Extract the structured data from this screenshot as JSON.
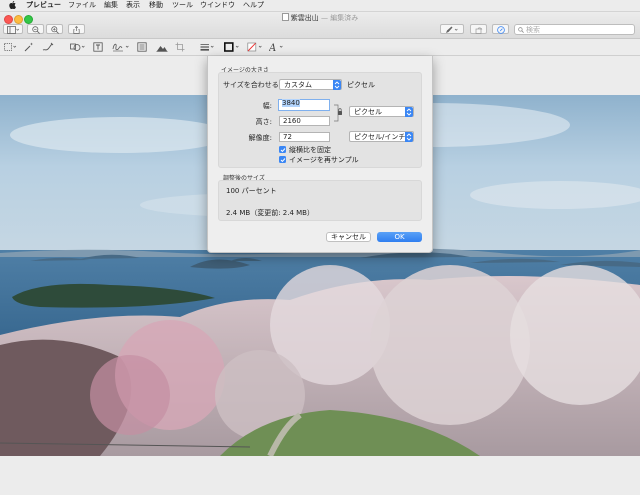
{
  "menubar": {
    "app": "プレビュー",
    "items": [
      "ファイル",
      "編集",
      "表示",
      "移動",
      "ツール",
      "ウインドウ",
      "ヘルプ"
    ]
  },
  "window": {
    "title": "紫雲出山",
    "edited": "— 編集済み"
  },
  "search": {
    "placeholder": "検索"
  },
  "dialog": {
    "image_size_label": "イメージの大きさ",
    "fit_label": "サイズを合わせる:",
    "fit_value": "カスタム",
    "fit_unit": "ピクセル",
    "width_label": "幅:",
    "width_value": "3840",
    "height_label": "高さ:",
    "height_value": "2160",
    "resolution_label": "解像度:",
    "resolution_value": "72",
    "dimension_unit": "ピクセル",
    "resolution_unit": "ピクセル/インチ",
    "scale_proportionally": "縦横比を固定",
    "resample": "イメージを再サンプル",
    "result_label": "調整後のサイズ",
    "result_percent": "100 パーセント",
    "result_size": "2.4 MB（変更前: 2.4 MB）",
    "cancel": "キャンセル",
    "ok": "OK"
  },
  "colors": {
    "accent": "#3a86f4",
    "sky": "#a9c6dc",
    "sea": "#3f6e96",
    "blossom": "#e9d3da"
  }
}
